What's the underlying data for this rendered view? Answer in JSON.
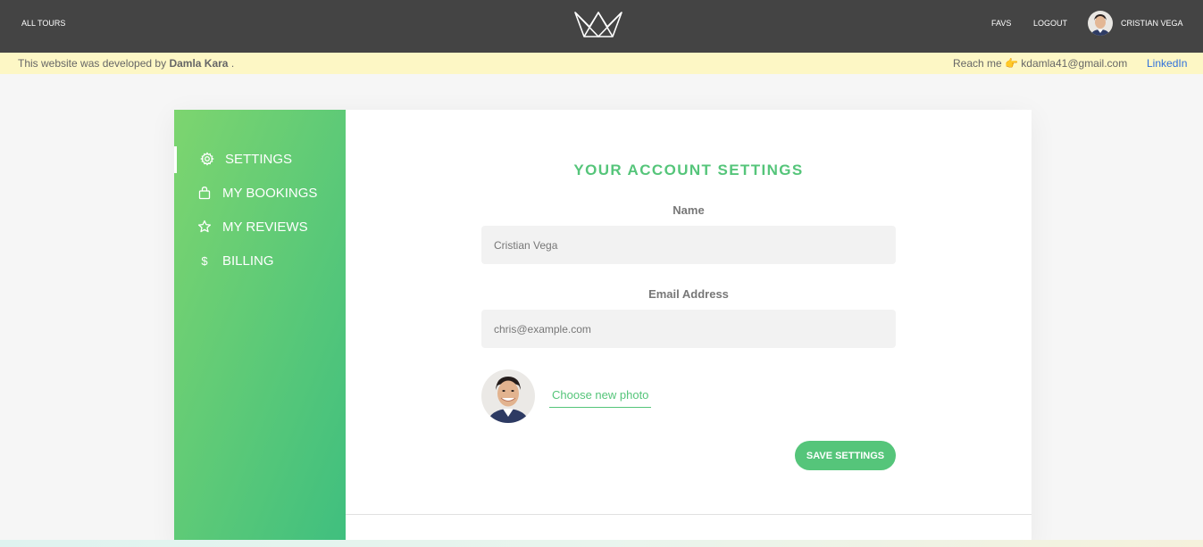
{
  "header": {
    "all_tours": "ALL TOURS",
    "favs": "FAVS",
    "logout": "LOGOUT",
    "user_name": "CRISTIAN VEGA"
  },
  "banner": {
    "prefix": "This website was developed by ",
    "author": "Damla Kara",
    "suffix": " .",
    "reach": "Reach me 👉 kdamla41@gmail.com",
    "linkedin": "LinkedIn"
  },
  "sidebar": {
    "items": [
      {
        "label": "SETTINGS",
        "icon": "settings-icon",
        "active": true
      },
      {
        "label": "MY BOOKINGS",
        "icon": "briefcase-icon",
        "active": false
      },
      {
        "label": "MY REVIEWS",
        "icon": "star-icon",
        "active": false
      },
      {
        "label": "BILLING",
        "icon": "dollar-icon",
        "active": false
      }
    ]
  },
  "account": {
    "heading": "YOUR ACCOUNT SETTINGS",
    "name_label": "Name",
    "name_value": "Cristian Vega",
    "email_label": "Email Address",
    "email_value": "chris@example.com",
    "choose_photo": "Choose new photo",
    "save_button": "SAVE SETTINGS"
  },
  "colors": {
    "primary_green": "#55c57a",
    "header_bg": "#444444",
    "banner_bg": "#fdf7c5",
    "link_blue": "#2f6fdb"
  }
}
